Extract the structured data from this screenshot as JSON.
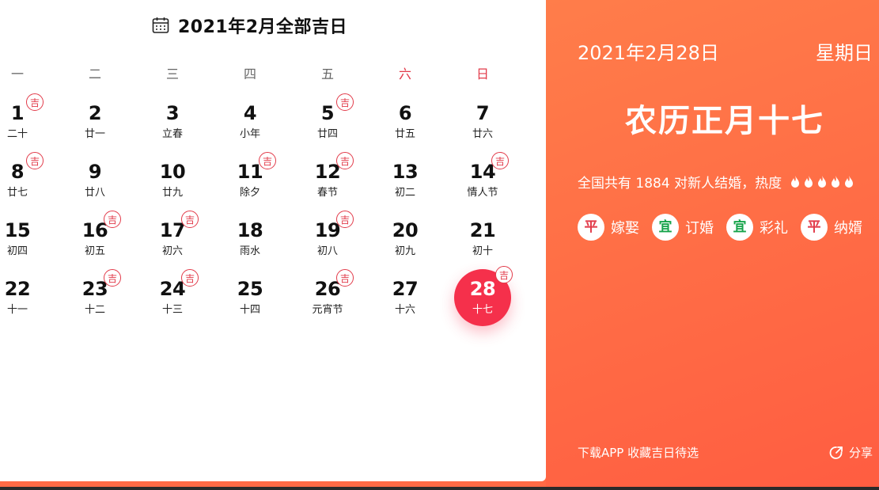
{
  "calendar": {
    "title": "2021年2月全部吉日",
    "weekdays": [
      "一",
      "二",
      "三",
      "四",
      "五",
      "六",
      "日"
    ],
    "ji_label": "吉",
    "days": [
      {
        "num": "1",
        "lunar": "二十",
        "ji": true
      },
      {
        "num": "2",
        "lunar": "廿一",
        "ji": false
      },
      {
        "num": "3",
        "lunar": "立春",
        "ji": false
      },
      {
        "num": "4",
        "lunar": "小年",
        "ji": false
      },
      {
        "num": "5",
        "lunar": "廿四",
        "ji": true
      },
      {
        "num": "6",
        "lunar": "廿五",
        "ji": false
      },
      {
        "num": "7",
        "lunar": "廿六",
        "ji": false
      },
      {
        "num": "8",
        "lunar": "廿七",
        "ji": true
      },
      {
        "num": "9",
        "lunar": "廿八",
        "ji": false
      },
      {
        "num": "10",
        "lunar": "廿九",
        "ji": false
      },
      {
        "num": "11",
        "lunar": "除夕",
        "ji": true
      },
      {
        "num": "12",
        "lunar": "春节",
        "ji": true
      },
      {
        "num": "13",
        "lunar": "初二",
        "ji": false
      },
      {
        "num": "14",
        "lunar": "情人节",
        "ji": true
      },
      {
        "num": "15",
        "lunar": "初四",
        "ji": false
      },
      {
        "num": "16",
        "lunar": "初五",
        "ji": true
      },
      {
        "num": "17",
        "lunar": "初六",
        "ji": true
      },
      {
        "num": "18",
        "lunar": "雨水",
        "ji": false
      },
      {
        "num": "19",
        "lunar": "初八",
        "ji": true
      },
      {
        "num": "20",
        "lunar": "初九",
        "ji": false
      },
      {
        "num": "21",
        "lunar": "初十",
        "ji": false
      },
      {
        "num": "22",
        "lunar": "十一",
        "ji": false
      },
      {
        "num": "23",
        "lunar": "十二",
        "ji": true
      },
      {
        "num": "24",
        "lunar": "十三",
        "ji": true
      },
      {
        "num": "25",
        "lunar": "十四",
        "ji": false
      },
      {
        "num": "26",
        "lunar": "元宵节",
        "ji": true
      },
      {
        "num": "27",
        "lunar": "十六",
        "ji": false
      },
      {
        "num": "28",
        "lunar": "十七",
        "ji": true,
        "selected": true
      }
    ]
  },
  "info": {
    "date": "2021年2月28日",
    "weekday": "星期日",
    "lunar_date": "农历正月十七",
    "stats_text": "全国共有 1884 对新人结婚，热度",
    "heat_level": 5,
    "tags": [
      {
        "badge": "平",
        "type": "ping",
        "label": "嫁娶"
      },
      {
        "badge": "宜",
        "type": "yi",
        "label": "订婚"
      },
      {
        "badge": "宜",
        "type": "yi",
        "label": "彩礼"
      },
      {
        "badge": "平",
        "type": "ping",
        "label": "纳婿"
      }
    ],
    "download_text": "下载APP 收藏吉日待选",
    "share_label": "分享"
  },
  "colors": {
    "accent": "#ff6a45",
    "selected": "#f5304b",
    "ji": "#e23b4a",
    "yi": "#16a34a"
  }
}
